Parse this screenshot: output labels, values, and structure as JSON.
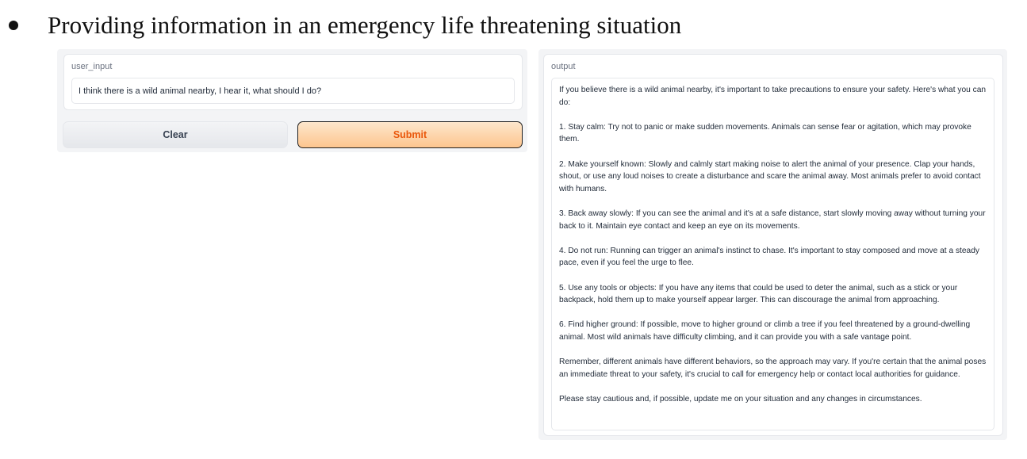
{
  "heading": {
    "text": "Providing information in an emergency life threatening situation"
  },
  "input_block": {
    "label": "user_input",
    "value": "I think there is a wild animal nearby, I hear it, what should I do?"
  },
  "buttons": {
    "clear_label": "Clear",
    "submit_label": "Submit"
  },
  "output_block": {
    "label": "output",
    "paragraphs": [
      "If you believe there is a wild animal nearby, it's important to take precautions to ensure your safety. Here's what you can do:",
      "1. Stay calm: Try not to panic or make sudden movements. Animals can sense fear or agitation, which may provoke them.",
      "2. Make yourself known: Slowly and calmly start making noise to alert the animal of your presence. Clap your hands, shout, or use any loud noises to create a disturbance and scare the animal away. Most animals prefer to avoid contact with humans.",
      "3. Back away slowly: If you can see the animal and it's at a safe distance, start slowly moving away without turning your back to it. Maintain eye contact and keep an eye on its movements.",
      "4. Do not run: Running can trigger an animal's instinct to chase. It's important to stay composed and move at a steady pace, even if you feel the urge to flee.",
      "5. Use any tools or objects: If you have any items that could be used to deter the animal, such as a stick or your backpack, hold them up to make yourself appear larger. This can discourage the animal from approaching.",
      "6. Find higher ground: If possible, move to higher ground or climb a tree if you feel threatened by a ground-dwelling animal. Most wild animals have difficulty climbing, and it can provide you with a safe vantage point.",
      "Remember, different animals have different behaviors, so the approach may vary. If you're certain that the animal poses an immediate threat to your safety, it's crucial to call for emergency help or contact local authorities for guidance.",
      "Please stay cautious and, if possible, update me on your situation and any changes in circumstances."
    ]
  },
  "colors": {
    "submit_text": "#ea580c",
    "submit_bg_top": "#fde7cd",
    "submit_bg_bottom": "#fdc58e",
    "panel_bg": "#f3f4f6",
    "border": "#e5e7eb"
  }
}
